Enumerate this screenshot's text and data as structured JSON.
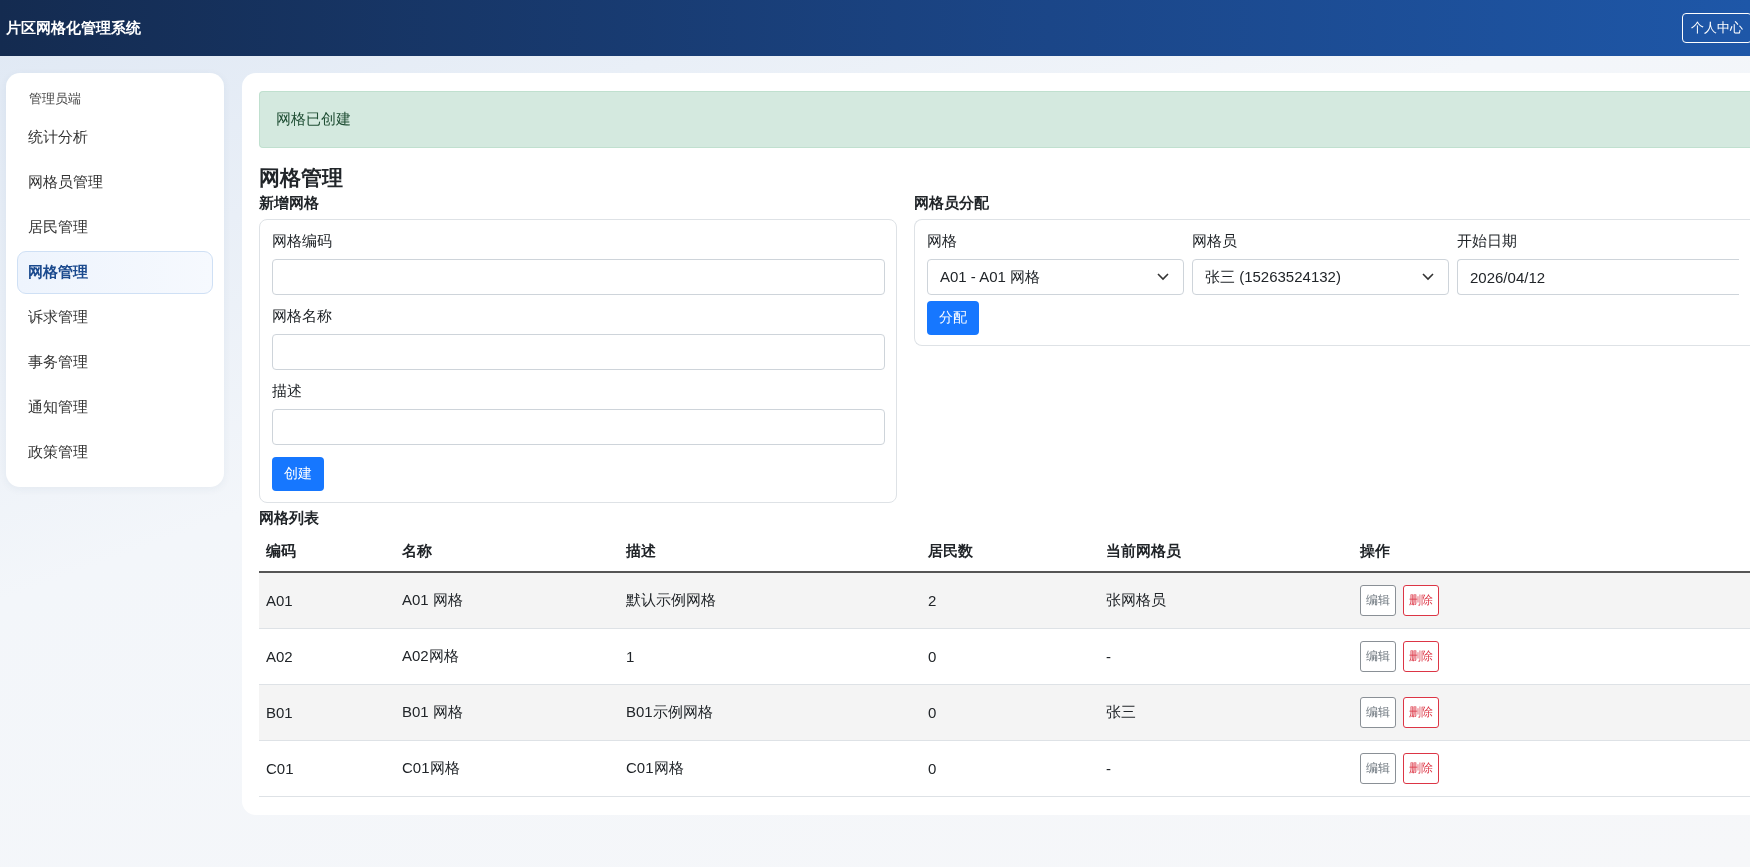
{
  "header": {
    "title": "片区网格化管理系统",
    "user_button": "个人中心"
  },
  "sidebar": {
    "section_label": "管理员端",
    "items": [
      {
        "label": "统计分析",
        "selected": false
      },
      {
        "label": "网格员管理",
        "selected": false
      },
      {
        "label": "居民管理",
        "selected": false
      },
      {
        "label": "网格管理",
        "selected": true
      },
      {
        "label": "诉求管理",
        "selected": false
      },
      {
        "label": "事务管理",
        "selected": false
      },
      {
        "label": "通知管理",
        "selected": false
      },
      {
        "label": "政策管理",
        "selected": false
      }
    ]
  },
  "alert": {
    "message": "网格已创建"
  },
  "page_title": "网格管理",
  "new_grid": {
    "title": "新增网格",
    "fields": [
      {
        "label": "网格编码"
      },
      {
        "label": "网格名称"
      },
      {
        "label": "描述"
      }
    ],
    "submit": "创建"
  },
  "assign": {
    "title": "网格员分配",
    "fields": [
      {
        "label": "网格",
        "kind": "select",
        "value": "A01 - A01 网格"
      },
      {
        "label": "网格员",
        "kind": "select",
        "value": "张三 (15263524132)"
      },
      {
        "label": "开始日期",
        "kind": "date",
        "value": "2026/04/12"
      }
    ],
    "submit": "分配"
  },
  "grid_list": {
    "title": "网格列表",
    "columns": [
      "编码",
      "名称",
      "描述",
      "居民数",
      "当前网格员",
      "操作"
    ],
    "rows": [
      {
        "cells": [
          "A01",
          "A01 网格",
          "默认示例网格",
          "2",
          "张网格员"
        ],
        "actions": [
          {
            "label": "编辑",
            "kind": "edit"
          },
          {
            "label": "删除",
            "kind": "delete"
          }
        ]
      },
      {
        "cells": [
          "A02",
          "A02网格",
          "1",
          "0",
          "-"
        ],
        "actions": [
          {
            "label": "编辑",
            "kind": "edit"
          },
          {
            "label": "删除",
            "kind": "delete"
          }
        ]
      },
      {
        "cells": [
          "B01",
          "B01 网格",
          "B01示例网格",
          "0",
          "张三"
        ],
        "actions": [
          {
            "label": "编辑",
            "kind": "edit"
          },
          {
            "label": "删除",
            "kind": "delete"
          }
        ]
      },
      {
        "cells": [
          "C01",
          "C01网格",
          "C01网格",
          "0",
          "-"
        ],
        "actions": [
          {
            "label": "编辑",
            "kind": "edit"
          },
          {
            "label": "删除",
            "kind": "delete"
          }
        ]
      }
    ]
  }
}
